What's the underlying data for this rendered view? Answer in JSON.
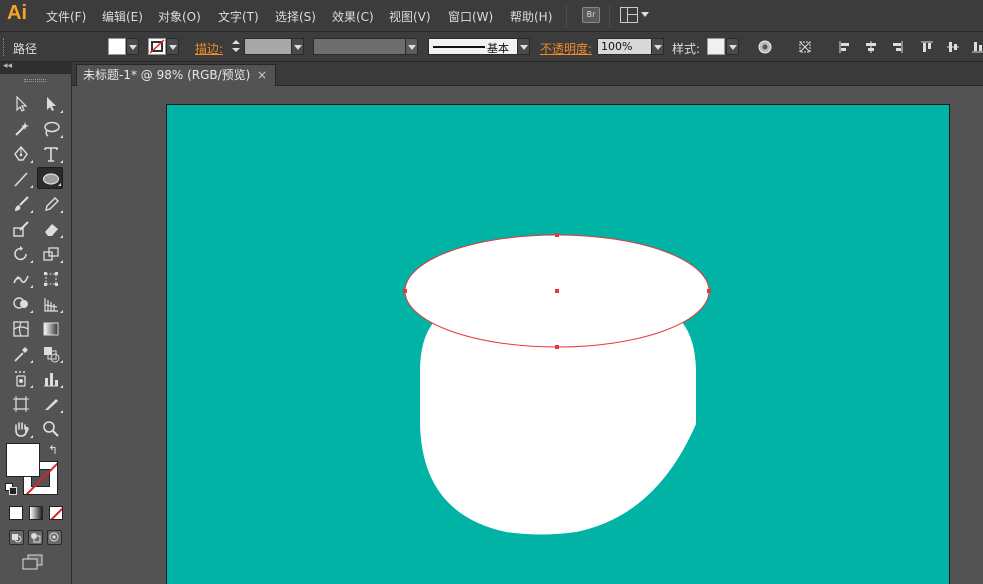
{
  "app": {
    "logo": "Ai"
  },
  "menubar": {
    "items": [
      "文件(F)",
      "编辑(E)",
      "对象(O)",
      "文字(T)",
      "选择(S)",
      "效果(C)",
      "视图(V)",
      "窗口(W)",
      "帮助(H)"
    ],
    "bridge_label": "Br"
  },
  "controlbar": {
    "selection_type": "路径",
    "stroke_label": "描边:",
    "stroke_profile": "基本",
    "opacity_label": "不透明度:",
    "opacity_value": "100%",
    "style_label": "样式:"
  },
  "document": {
    "tab_title": "未标题-1* @ 98% (RGB/预览)",
    "close_glyph": "×"
  },
  "colors": {
    "artboard": "#00b3a5",
    "shape_fill": "#ffffff",
    "path_highlight": "#e8363f",
    "accent": "#f7a325"
  },
  "tools": [
    "selection-tool",
    "direct-selection-tool",
    "magic-wand-tool",
    "lasso-tool",
    "pen-tool",
    "type-tool",
    "line-segment-tool",
    "ellipse-tool",
    "paintbrush-tool",
    "pencil-tool",
    "blob-brush-tool",
    "eraser-tool",
    "rotate-tool",
    "scale-tool",
    "warp-tool",
    "free-transform-tool",
    "shape-builder-tool",
    "perspective-grid-tool",
    "mesh-tool",
    "gradient-tool",
    "eyedropper-tool",
    "blend-tool",
    "symbol-sprayer-tool",
    "column-graph-tool",
    "artboard-tool",
    "slice-tool",
    "hand-tool",
    "zoom-tool"
  ]
}
